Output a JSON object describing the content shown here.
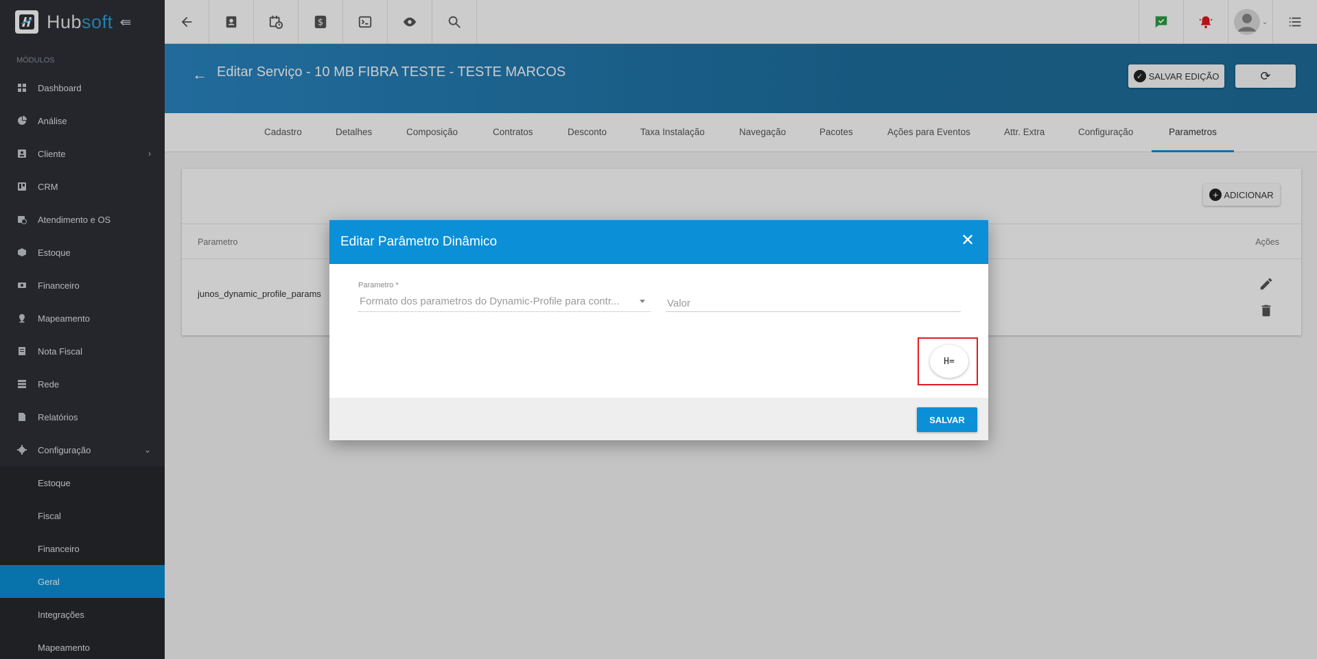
{
  "app": {
    "logo_hub": "Hub",
    "logo_soft": "soft"
  },
  "sidebar": {
    "section_label": "MÓDULOS",
    "items": [
      {
        "label": "Dashboard",
        "icon": "dashboard-icon"
      },
      {
        "label": "Análise",
        "icon": "pie-chart-icon"
      },
      {
        "label": "Cliente",
        "icon": "contact-card-icon"
      },
      {
        "label": "CRM",
        "icon": "trello-board-icon"
      },
      {
        "label": "Atendimento e OS",
        "icon": "calendar-clock-icon"
      },
      {
        "label": "Estoque",
        "icon": "box-icon"
      },
      {
        "label": "Financeiro",
        "icon": "money-icon"
      },
      {
        "label": "Mapeamento",
        "icon": "map-pin-icon"
      },
      {
        "label": "Nota Fiscal",
        "icon": "receipt-icon"
      },
      {
        "label": "Rede",
        "icon": "server-icon"
      },
      {
        "label": "Relatórios",
        "icon": "file-icon"
      },
      {
        "label": "Configuração",
        "icon": "gear-icon"
      }
    ],
    "sub_items": [
      {
        "label": "Estoque"
      },
      {
        "label": "Fiscal"
      },
      {
        "label": "Financeiro"
      },
      {
        "label": "Geral"
      },
      {
        "label": "Integrações"
      },
      {
        "label": "Mapeamento"
      }
    ]
  },
  "header": {
    "title": "Editar Serviço - 10 MB FIBRA TESTE - TESTE MARCOS",
    "save_edit_label": "SALVAR EDIÇÃO"
  },
  "tabs": [
    {
      "label": "Cadastro"
    },
    {
      "label": "Detalhes"
    },
    {
      "label": "Composição"
    },
    {
      "label": "Contratos"
    },
    {
      "label": "Desconto"
    },
    {
      "label": "Taxa Instalação"
    },
    {
      "label": "Navegação"
    },
    {
      "label": "Pacotes"
    },
    {
      "label": "Ações para Eventos"
    },
    {
      "label": "Attr. Extra"
    },
    {
      "label": "Configuração"
    },
    {
      "label": "Parametros"
    }
  ],
  "card": {
    "add_label": "ADICIONAR",
    "col_param": "Parametro",
    "col_actions": "Ações",
    "rows": [
      {
        "param": "junos_dynamic_profile_params"
      }
    ]
  },
  "modal": {
    "title": "Editar Parâmetro Dinâmico",
    "param_label": "Parametro *",
    "param_value": "Formato dos parametros do Dynamic-Profile para contr...",
    "valor_placeholder": "Valor",
    "fab_label": "H=",
    "save_label": "SALVAR"
  }
}
